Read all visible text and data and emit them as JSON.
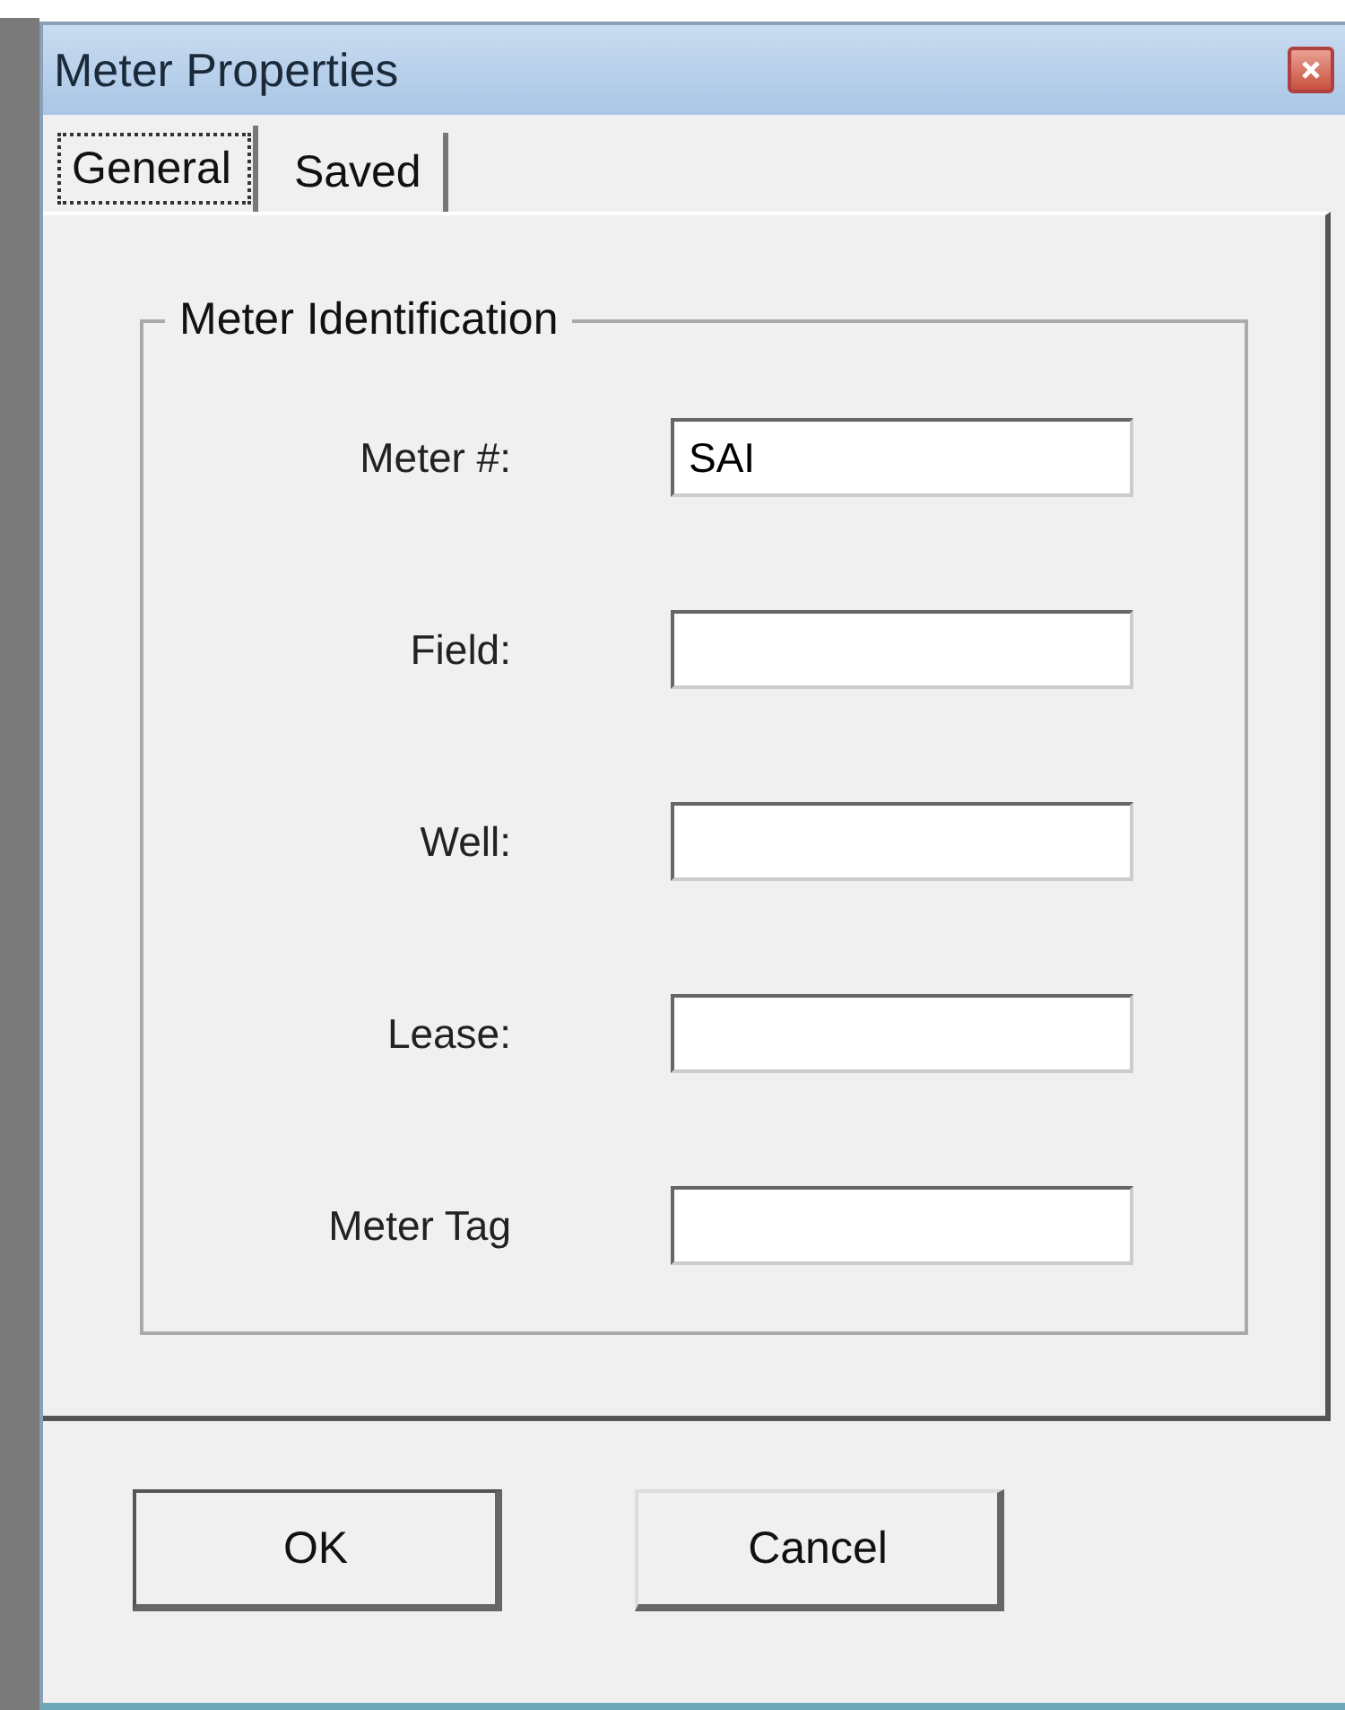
{
  "window": {
    "title": "Meter Properties"
  },
  "tabs": [
    {
      "label": "General",
      "selected": true
    },
    {
      "label": "Saved",
      "selected": false
    }
  ],
  "group": {
    "title": "Meter Identification",
    "fields": [
      {
        "label": "Meter #:",
        "value": "SAI"
      },
      {
        "label": "Field:"
      },
      {
        "label": "Well:"
      },
      {
        "label": "Lease:"
      },
      {
        "label": "Meter Tag"
      }
    ]
  },
  "buttons": [
    {
      "label": "OK",
      "default": true
    },
    {
      "label": "Cancel",
      "default": false
    }
  ]
}
